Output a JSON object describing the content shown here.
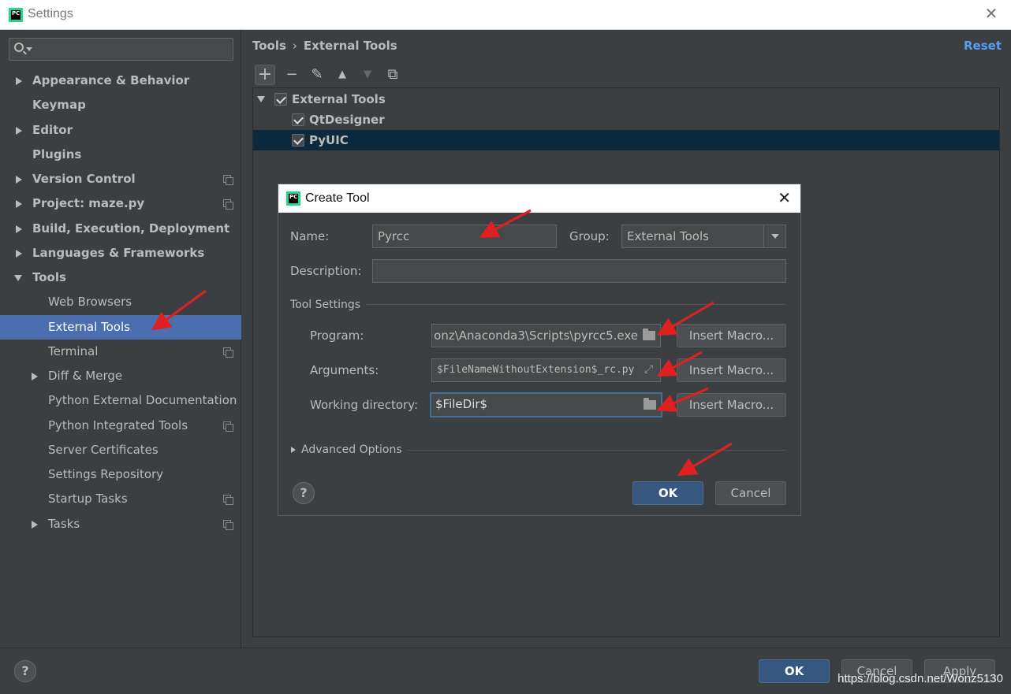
{
  "window": {
    "title": "Settings",
    "app_icon_text": "PC",
    "close": "✕"
  },
  "sidebar": {
    "search_placeholder": "",
    "items": [
      {
        "label": "Appearance & Behavior",
        "expandable": true
      },
      {
        "label": "Keymap",
        "expandable": false
      },
      {
        "label": "Editor",
        "expandable": true
      },
      {
        "label": "Plugins",
        "expandable": false
      },
      {
        "label": "Version Control",
        "expandable": true
      },
      {
        "label": "Project: maze.py",
        "expandable": true
      },
      {
        "label": "Build, Execution, Deployment",
        "expandable": true
      },
      {
        "label": "Languages & Frameworks",
        "expandable": true
      },
      {
        "label": "Tools",
        "expandable": true,
        "expanded": true
      },
      {
        "label": "Web Browsers"
      },
      {
        "label": "External Tools",
        "selected": true
      },
      {
        "label": "Terminal"
      },
      {
        "label": "Diff & Merge",
        "expandable": true
      },
      {
        "label": "Python External Documentation"
      },
      {
        "label": "Python Integrated Tools"
      },
      {
        "label": "Server Certificates"
      },
      {
        "label": "Settings Repository"
      },
      {
        "label": "Startup Tasks"
      },
      {
        "label": "Tasks",
        "expandable": true
      }
    ]
  },
  "content": {
    "breadcrumb": [
      "Tools",
      "›",
      "External Tools"
    ],
    "reset_label": "Reset",
    "toolbar": {
      "add": "+",
      "remove": "−",
      "edit": "✎",
      "up": "▲",
      "down": "▼",
      "copy": "⧉"
    },
    "tree": [
      {
        "label": "External Tools",
        "checked": true,
        "group": true
      },
      {
        "label": "QtDesigner",
        "checked": true
      },
      {
        "label": "PyUIC",
        "checked": true,
        "selected": true
      }
    ]
  },
  "dialog": {
    "title": "Create Tool",
    "app_icon_text": "PC",
    "close": "✕",
    "name_label": "Name:",
    "name_value": "Pyrcc",
    "group_label": "Group:",
    "group_value": "External Tools",
    "description_label": "Description:",
    "description_value": "",
    "tool_settings_label": "Tool Settings",
    "program_label": "Program:",
    "program_value": "onz\\Anaconda3\\Scripts\\pyrcc5.exe",
    "arguments_label": "Arguments:",
    "arguments_value": "$FileNameWithoutExtension$_rc.py",
    "workdir_label": "Working directory:",
    "workdir_value": "$FileDir$",
    "insert_macro_label": "Insert Macro...",
    "advanced_label": "Advanced Options",
    "help": "?",
    "ok_label": "OK",
    "cancel_label": "Cancel"
  },
  "footer": {
    "help": "?",
    "ok_label": "OK",
    "cancel_label": "Cancel",
    "apply_label": "Apply",
    "watermark": "https://blog.csdn.net/Wonz5130"
  },
  "colors": {
    "background": "#3c3f41",
    "selection": "#4b6eaf",
    "tree_selection": "#0d293e",
    "primary_button": "#365880",
    "link": "#589df6",
    "annotation_arrow": "#e02020"
  }
}
